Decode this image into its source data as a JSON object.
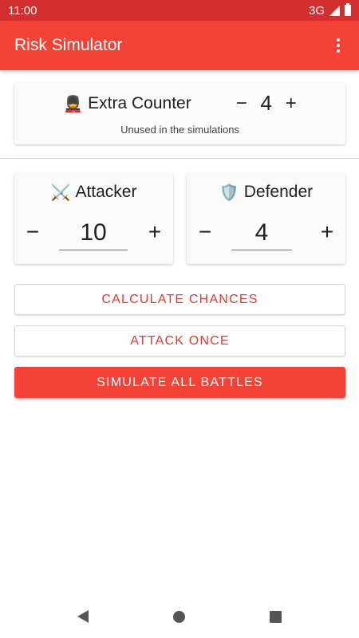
{
  "status_bar": {
    "time": "11:00",
    "network": "3G"
  },
  "app_bar": {
    "title": "Risk Simulator"
  },
  "extra_counter": {
    "icon": "💂",
    "title": "Extra Counter",
    "minus": "−",
    "value": "4",
    "plus": "+",
    "subtitle": "Unused in the simulations"
  },
  "attacker": {
    "icon": "⚔️",
    "title": "Attacker",
    "minus": "−",
    "value": "10",
    "plus": "+"
  },
  "defender": {
    "icon": "🛡️",
    "title": "Defender",
    "minus": "−",
    "value": "4",
    "plus": "+"
  },
  "buttons": {
    "calculate": "CALCULATE CHANCES",
    "attack_once": "ATTACK ONCE",
    "simulate": "SIMULATE ALL BATTLES"
  },
  "colors": {
    "primary": "#f44336",
    "primary_dark": "#d32f2f",
    "accent_red": "#e53935",
    "accent_blue": "#1e88e5"
  }
}
